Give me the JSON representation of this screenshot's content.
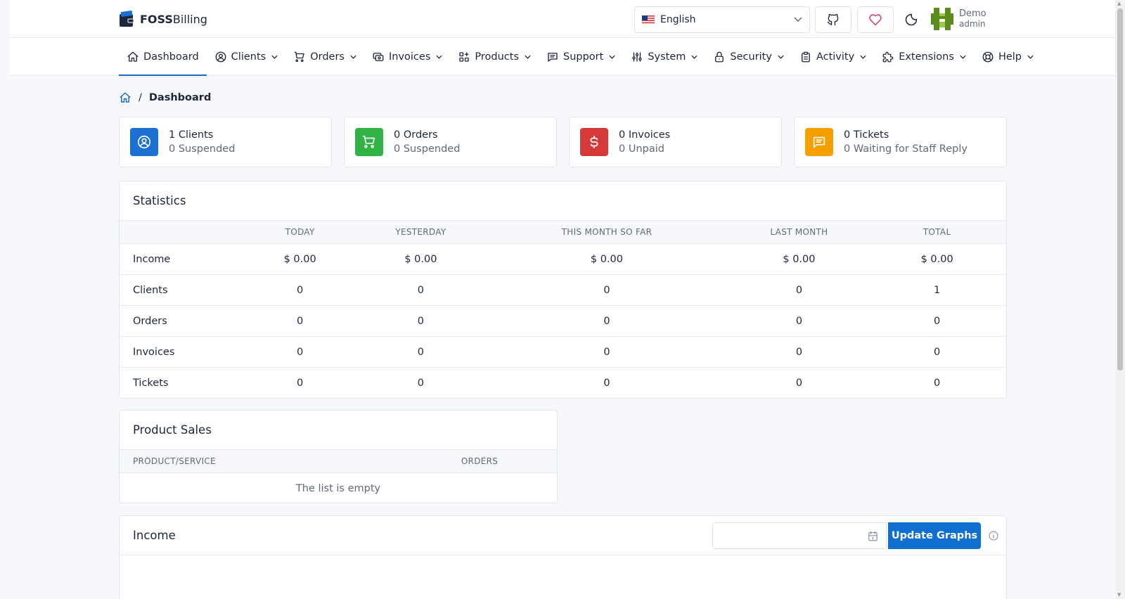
{
  "brand": {
    "name_bold": "FOSS",
    "name_rest": "Billing"
  },
  "header": {
    "language": "English",
    "user_name": "Demo",
    "user_role": "admin"
  },
  "nav": {
    "items": [
      {
        "label": "Dashboard",
        "icon": "home-icon"
      },
      {
        "label": "Clients",
        "icon": "user-circle-icon"
      },
      {
        "label": "Orders",
        "icon": "cart-icon"
      },
      {
        "label": "Invoices",
        "icon": "cash-icon"
      },
      {
        "label": "Products",
        "icon": "apps-icon"
      },
      {
        "label": "Support",
        "icon": "message-icon"
      },
      {
        "label": "System",
        "icon": "adjustments-icon"
      },
      {
        "label": "Security",
        "icon": "lock-icon"
      },
      {
        "label": "Activity",
        "icon": "clipboard-icon"
      },
      {
        "label": "Extensions",
        "icon": "puzzle-icon"
      },
      {
        "label": "Help",
        "icon": "lifebuoy-icon"
      }
    ]
  },
  "breadcrumb": {
    "current": "Dashboard",
    "separator": "/"
  },
  "stat_cards": [
    {
      "line1": "1 Clients",
      "line2": "0 Suspended",
      "color": "#1d70d3",
      "icon": "user-circle-icon"
    },
    {
      "line1": "0 Orders",
      "line2": "0 Suspended",
      "color": "#2fb344",
      "icon": "cart-icon"
    },
    {
      "line1": "0 Invoices",
      "line2": "0 Unpaid",
      "color": "#d63939",
      "icon": "dollar-icon"
    },
    {
      "line1": "0 Tickets",
      "line2": "0 Waiting for Staff Reply",
      "color": "#f59f00",
      "icon": "message-icon"
    }
  ],
  "statistics": {
    "title": "Statistics",
    "columns": [
      "",
      "TODAY",
      "YESTERDAY",
      "THIS MONTH SO FAR",
      "LAST MONTH",
      "TOTAL"
    ],
    "rows": [
      [
        "Income",
        "$ 0.00",
        "$ 0.00",
        "$ 0.00",
        "$ 0.00",
        "$ 0.00"
      ],
      [
        "Clients",
        "0",
        "0",
        "0",
        "0",
        "1"
      ],
      [
        "Orders",
        "0",
        "0",
        "0",
        "0",
        "0"
      ],
      [
        "Invoices",
        "0",
        "0",
        "0",
        "0",
        "0"
      ],
      [
        "Tickets",
        "0",
        "0",
        "0",
        "0",
        "0"
      ]
    ]
  },
  "product_sales": {
    "title": "Product Sales",
    "col_product": "PRODUCT/SERVICE",
    "col_orders": "ORDERS",
    "empty_text": "The list is empty"
  },
  "income": {
    "title": "Income",
    "date_value": "",
    "update_label": "Update Graphs"
  }
}
